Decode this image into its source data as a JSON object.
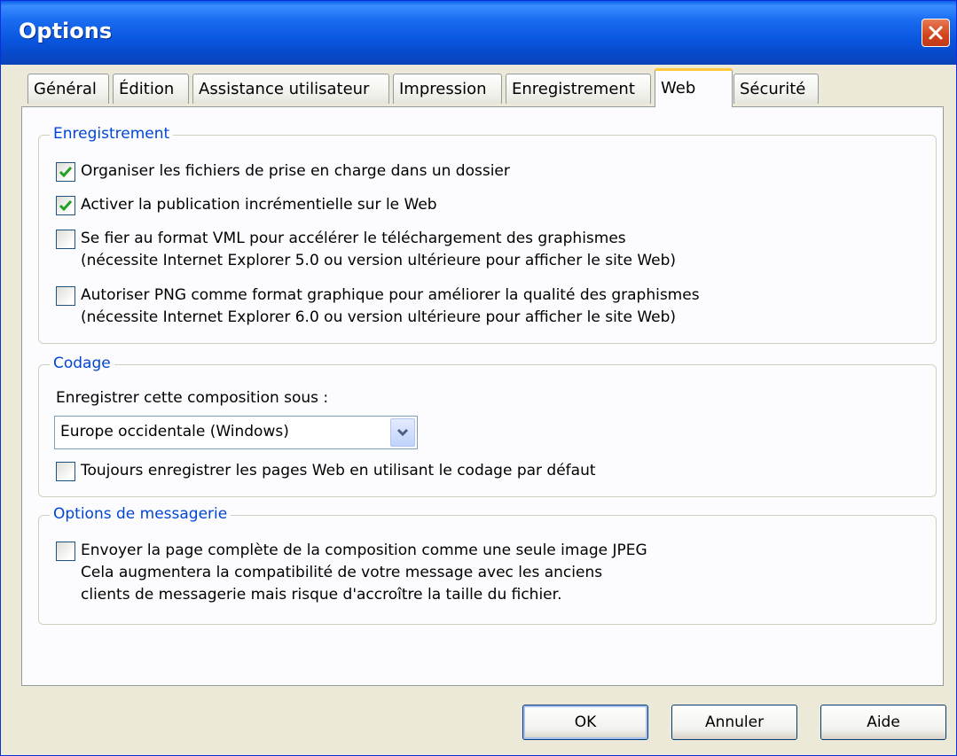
{
  "window": {
    "title": "Options"
  },
  "tabs": [
    {
      "label": "Général"
    },
    {
      "label": "Édition"
    },
    {
      "label": "Assistance utilisateur"
    },
    {
      "label": "Impression"
    },
    {
      "label": "Enregistrement"
    },
    {
      "label": "Web",
      "active": true
    },
    {
      "label": "Sécurité"
    }
  ],
  "groups": {
    "enregistrement": {
      "legend": "Enregistrement",
      "options": [
        {
          "checked": true,
          "line1": "Organiser les fichiers de prise en charge dans un dossier"
        },
        {
          "checked": true,
          "line1": "Activer la publication incrémentielle sur le Web"
        },
        {
          "checked": false,
          "line1": "Se fier au format VML pour accélérer le téléchargement des graphismes",
          "line2": "(nécessite Internet Explorer 5.0 ou version ultérieure pour afficher le site Web)"
        },
        {
          "checked": false,
          "line1": "Autoriser PNG comme format graphique pour améliorer la qualité des graphismes",
          "line2": "(nécessite Internet Explorer 6.0 ou version ultérieure pour afficher le site Web)"
        }
      ]
    },
    "codage": {
      "legend": "Codage",
      "save_as_label": "Enregistrer cette composition sous :",
      "encoding_value": "Europe occidentale (Windows)",
      "always_default": {
        "checked": false,
        "line1": "Toujours enregistrer les pages Web en utilisant le codage par défaut"
      }
    },
    "messagerie": {
      "legend": "Options de messagerie",
      "send_jpeg": {
        "checked": false,
        "line1": "Envoyer la page complète de la composition comme une seule image JPEG",
        "line2": "Cela augmentera la compatibilité de votre message avec les anciens",
        "line3": "clients de messagerie mais risque d'accroître la taille du fichier."
      }
    }
  },
  "buttons": {
    "ok": "OK",
    "cancel": "Annuler",
    "help": "Aide"
  },
  "colors": {
    "titlebar": "#0a56e0",
    "legend": "#0046d5",
    "check": "#21a121",
    "close": "#d2431a",
    "active_tab_highlight": "#ffc83c"
  },
  "icons": {
    "close": "close-icon",
    "check": "checkmark-icon",
    "dropdown": "chevron-down-icon"
  }
}
